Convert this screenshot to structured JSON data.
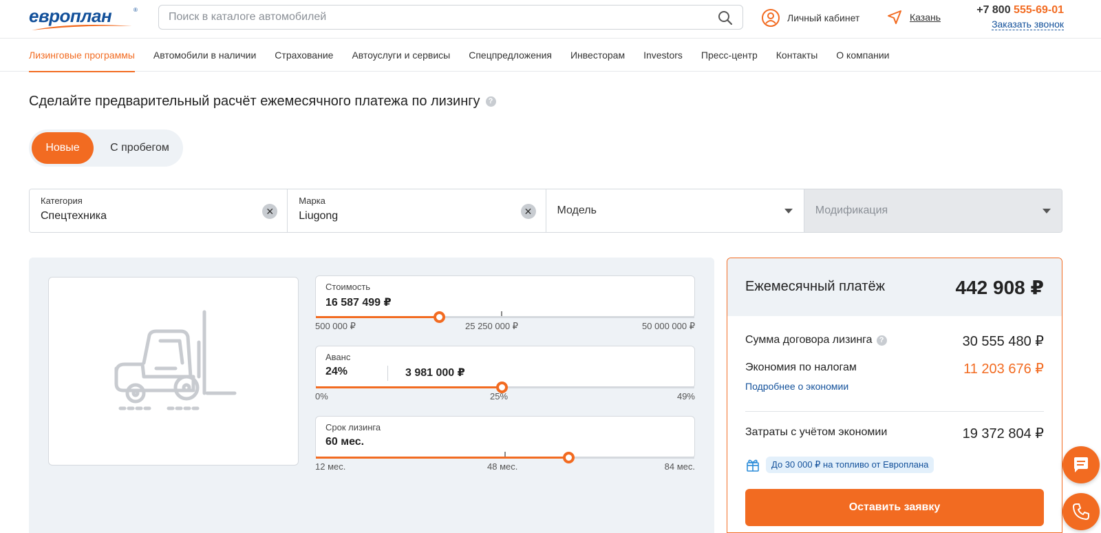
{
  "header": {
    "logo_text": "европлан",
    "logo_reg": "®",
    "search_placeholder": "Поиск в каталоге автомобилей",
    "cabinet_label": "Личный кабинет",
    "city": "Казань",
    "phone_prefix": "+7 800 ",
    "phone_accent": "555-69-01",
    "callback_label": "Заказать звонок"
  },
  "nav": {
    "items": [
      {
        "label": "Лизинговые программы",
        "active": true
      },
      {
        "label": "Автомобили в наличии"
      },
      {
        "label": "Страхование"
      },
      {
        "label": "Автоуслуги и сервисы"
      },
      {
        "label": "Спецпредложения"
      },
      {
        "label": "Инвесторам"
      },
      {
        "label": "Investors"
      },
      {
        "label": "Пресс-центр"
      },
      {
        "label": "Контакты"
      },
      {
        "label": "О компании"
      }
    ]
  },
  "page": {
    "title": "Сделайте предварительный расчёт ежемесячного платежа по лизингу",
    "help_glyph": "?"
  },
  "toggle": {
    "active_label": "Новые",
    "idle_label": "С пробегом"
  },
  "filters": {
    "category": {
      "label": "Категория",
      "value": "Спецтехника"
    },
    "brand": {
      "label": "Марка",
      "value": "Liugong"
    },
    "model": {
      "placeholder": "Модель"
    },
    "modification": {
      "placeholder": "Модификация",
      "disabled": true
    },
    "clear_glyph": "✕"
  },
  "calculator": {
    "cost": {
      "label": "Стоимость",
      "value": "16 587 499 ₽",
      "min": "500 000 ₽",
      "mid": "25 250 000 ₽",
      "max": "50 000 000 ₽",
      "fraction": 0.325
    },
    "advance": {
      "label": "Аванс",
      "percent": "24%",
      "amount": "3 981 000 ₽",
      "min": "0%",
      "mid": "25%",
      "max": "49%",
      "fraction": 0.49
    },
    "term": {
      "label": "Срок лизинга",
      "value": "60 мес.",
      "min": "12 мес.",
      "mid": "48 мес.",
      "max": "84 мес.",
      "fraction": 0.667
    }
  },
  "result": {
    "monthly_label": "Ежемесячный платёж",
    "monthly_value": "442 908 ₽",
    "contract_label": "Сумма договора лизинга",
    "contract_value": "30 555 480 ₽",
    "tax_label": "Экономия по налогам",
    "tax_value": "11 203 676 ₽",
    "tax_link": "Подробнее о экономии",
    "costs_label": "Затраты с учётом экономии",
    "costs_value": "19 372 804 ₽",
    "promo": "До 30 000 ₽ на топливо от Европлана",
    "submit_label": "Оставить заявку"
  },
  "colors": {
    "accent": "#f26b21",
    "brand": "#12509a",
    "panel": "#eef2f6"
  },
  "icons": [
    "search-icon",
    "user-icon",
    "location-arrow-icon",
    "help-icon",
    "clear-icon",
    "chevron-down-icon",
    "forklift-placeholder-icon",
    "gift-icon",
    "chat-icon",
    "phone-icon"
  ]
}
